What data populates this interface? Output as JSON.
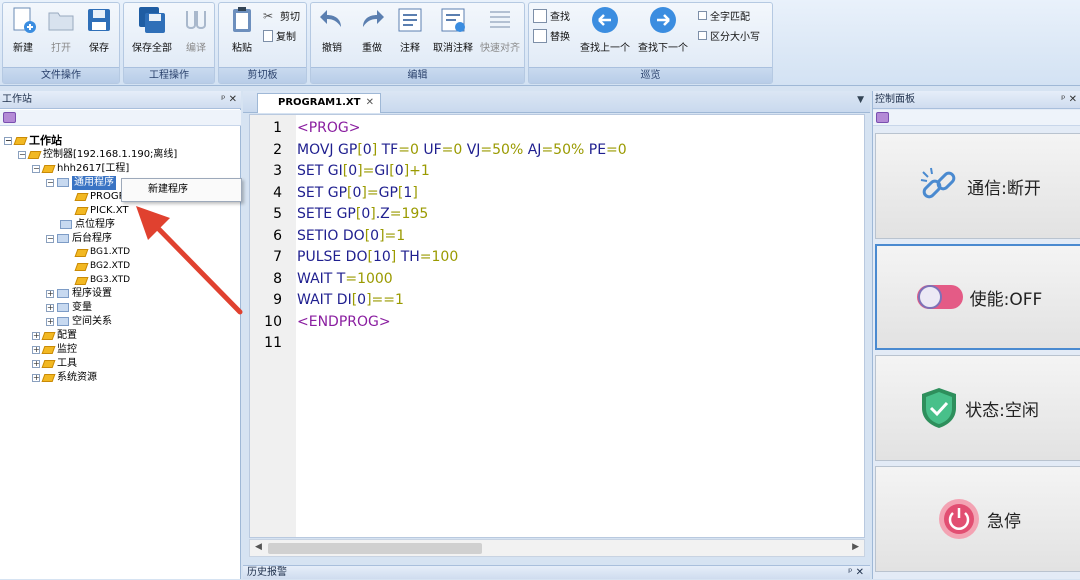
{
  "ribbon": {
    "groups": [
      {
        "label": "文件操作",
        "buttons": [
          "新建",
          "打开",
          "保存"
        ]
      },
      {
        "label": "工程操作",
        "buttons": [
          "保存全部",
          "编译"
        ]
      },
      {
        "label": "剪切板",
        "buttons": [
          "粘贴"
        ],
        "small": [
          "剪切",
          "复制"
        ]
      },
      {
        "label": "编辑",
        "buttons": [
          "撤销",
          "重做",
          "注释",
          "取消注释",
          "快速对齐"
        ]
      },
      {
        "label": "巡览",
        "small": [
          "查找",
          "替换"
        ],
        "buttons": [
          "查找上一个",
          "查找下一个"
        ],
        "checks": [
          "全字匹配",
          "区分大小写"
        ]
      }
    ]
  },
  "workstation": {
    "title": "工作站",
    "controls": "ᵖ ✕",
    "tree": {
      "root": "工作站",
      "controller": "控制器[192.168.1.190;离线]",
      "project": "hhh2617[工程]",
      "general": "通用程序",
      "prog1": "PROGR",
      "pick": "PICK.XT",
      "point": "点位程序",
      "background": "后台程序",
      "bg1": "BG1.XTD",
      "bg2": "BG2.XTD",
      "bg3": "BG3.XTD",
      "settings": "程序设置",
      "variables": "变量",
      "space": "空间关系",
      "config": "配置",
      "monitor": "监控",
      "tools": "工具",
      "sysres": "系统资源"
    },
    "context_menu": "新建程序"
  },
  "editor": {
    "tab": "PROGRAM1.XT",
    "lines": [
      {
        "n": "1",
        "parts": [
          [
            "tagc",
            "<PROG>"
          ]
        ]
      },
      {
        "n": "2",
        "parts": [
          [
            "kw",
            "MOVJ GP"
          ],
          [
            "nm",
            "["
          ],
          [
            "kw",
            "0"
          ],
          [
            "nm",
            "]"
          ],
          [
            "kw",
            " TF"
          ],
          [
            "nm",
            "=0"
          ],
          [
            "kw",
            " UF"
          ],
          [
            "nm",
            "=0"
          ],
          [
            "kw",
            " VJ"
          ],
          [
            "nm",
            "=50%"
          ],
          [
            "kw",
            " AJ"
          ],
          [
            "nm",
            "=50%"
          ],
          [
            "kw",
            " PE"
          ],
          [
            "nm",
            "=0"
          ]
        ]
      },
      {
        "n": "3",
        "parts": [
          [
            "kw",
            "SET GI"
          ],
          [
            "nm",
            "["
          ],
          [
            "kw",
            "0"
          ],
          [
            "nm",
            "]="
          ],
          [
            "kw",
            "GI"
          ],
          [
            "nm",
            "["
          ],
          [
            "kw",
            "0"
          ],
          [
            "nm",
            "]+1"
          ]
        ]
      },
      {
        "n": "4",
        "parts": [
          [
            "kw",
            "SET GP"
          ],
          [
            "nm",
            "["
          ],
          [
            "kw",
            "0"
          ],
          [
            "nm",
            "]="
          ],
          [
            "kw",
            "GP"
          ],
          [
            "nm",
            "["
          ],
          [
            "kw",
            "1"
          ],
          [
            "nm",
            "]"
          ]
        ]
      },
      {
        "n": "5",
        "parts": [
          [
            "kw",
            "SETE GP"
          ],
          [
            "nm",
            "["
          ],
          [
            "kw",
            "0"
          ],
          [
            "nm",
            "]"
          ],
          [
            "kw",
            ".Z"
          ],
          [
            "nm",
            "=195"
          ]
        ]
      },
      {
        "n": "6",
        "parts": [
          [
            "kw",
            "SETIO DO"
          ],
          [
            "nm",
            "["
          ],
          [
            "kw",
            "0"
          ],
          [
            "nm",
            "]=1"
          ]
        ]
      },
      {
        "n": "7",
        "parts": [
          [
            "kw",
            "PULSE DO"
          ],
          [
            "nm",
            "["
          ],
          [
            "kw",
            "10"
          ],
          [
            "nm",
            "]"
          ],
          [
            "kw",
            " TH"
          ],
          [
            "nm",
            "=100"
          ]
        ]
      },
      {
        "n": "8",
        "parts": [
          [
            "kw",
            "WAIT T"
          ],
          [
            "nm",
            "=1000"
          ]
        ]
      },
      {
        "n": "9",
        "parts": [
          [
            "kw",
            "WAIT DI"
          ],
          [
            "nm",
            "["
          ],
          [
            "kw",
            "0"
          ],
          [
            "nm",
            "]==1"
          ]
        ]
      },
      {
        "n": "10",
        "parts": [
          [
            "tagc",
            "<ENDPROG>"
          ]
        ]
      },
      {
        "n": "11",
        "parts": []
      }
    ]
  },
  "history": {
    "title": "历史报警",
    "controls": "ᵖ ✕"
  },
  "control_panel": {
    "title": "控制面板",
    "controls": "ᵖ ✕",
    "comm": "通信:断开",
    "enable": "使能:OFF",
    "status": "状态:空闲",
    "estop": "急停"
  },
  "colors": {
    "keyword": "#1f1f8f",
    "tag": "#8a1ea0",
    "number": "#9a9a00",
    "accent": "#3a74c4",
    "arrow": "#e0412f"
  }
}
